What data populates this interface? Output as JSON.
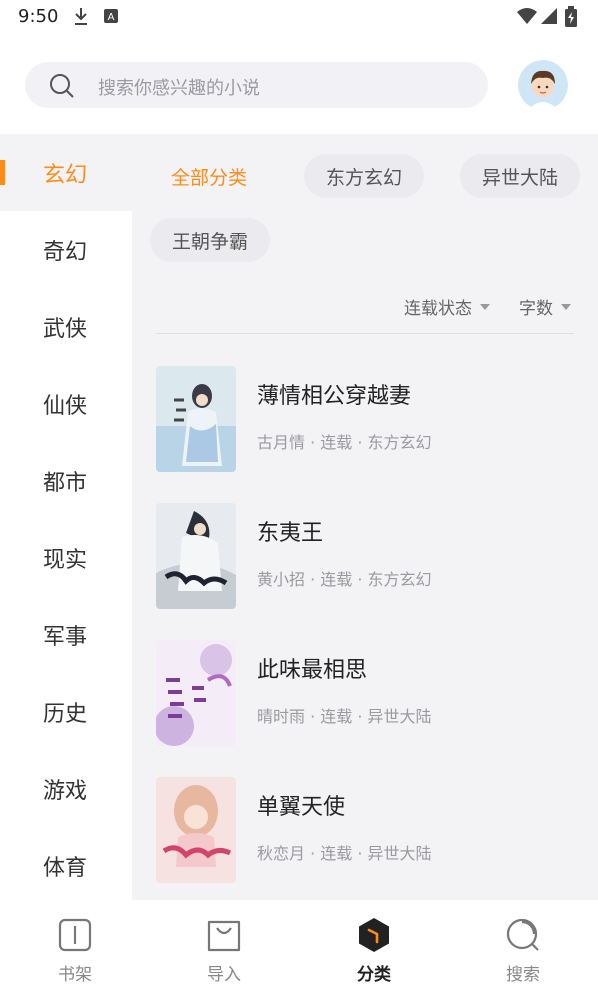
{
  "status_bar": {
    "time": "9:50",
    "icons": [
      "download-icon",
      "a-badge-icon",
      "wifi-icon",
      "signal-icon",
      "battery-charging-icon"
    ]
  },
  "header": {
    "search_placeholder": "搜索你感兴趣的小说",
    "avatar": "cartoon-boy-avatar"
  },
  "sidebar": {
    "items": [
      {
        "label": "玄幻",
        "active": true
      },
      {
        "label": "奇幻",
        "active": false
      },
      {
        "label": "武侠",
        "active": false
      },
      {
        "label": "仙侠",
        "active": false
      },
      {
        "label": "都市",
        "active": false
      },
      {
        "label": "现实",
        "active": false
      },
      {
        "label": "军事",
        "active": false
      },
      {
        "label": "历史",
        "active": false
      },
      {
        "label": "游戏",
        "active": false
      },
      {
        "label": "体育",
        "active": false
      }
    ]
  },
  "subcategories": {
    "items": [
      {
        "label": "全部分类",
        "active": true
      },
      {
        "label": "东方玄幻",
        "active": false
      },
      {
        "label": "异世大陆",
        "active": false
      },
      {
        "label": "王朝争霸",
        "active": false
      }
    ]
  },
  "filters": {
    "status_label": "连载状态",
    "words_label": "字数"
  },
  "books": [
    {
      "title": "薄情相公穿越妻",
      "meta": "古月情 · 连载 · 东方玄幻"
    },
    {
      "title": "东夷王",
      "meta": "黄小招 · 连载 · 东方玄幻"
    },
    {
      "title": "此味最相思",
      "meta": "晴时雨 · 连载 · 异世大陆"
    },
    {
      "title": "单翼天使",
      "meta": "秋恋月 · 连载 · 异世大陆"
    }
  ],
  "bottom_nav": {
    "items": [
      {
        "label": "书架",
        "icon": "bookshelf-icon",
        "active": false
      },
      {
        "label": "导入",
        "icon": "import-bag-icon",
        "active": false
      },
      {
        "label": "分类",
        "icon": "category-hexagon-icon",
        "active": true
      },
      {
        "label": "搜索",
        "icon": "search-nav-icon",
        "active": false
      }
    ]
  },
  "colors": {
    "accent": "#ff8c1a",
    "background": "#f3f3f6",
    "text": "#333333",
    "muted": "#9a9aa0"
  }
}
